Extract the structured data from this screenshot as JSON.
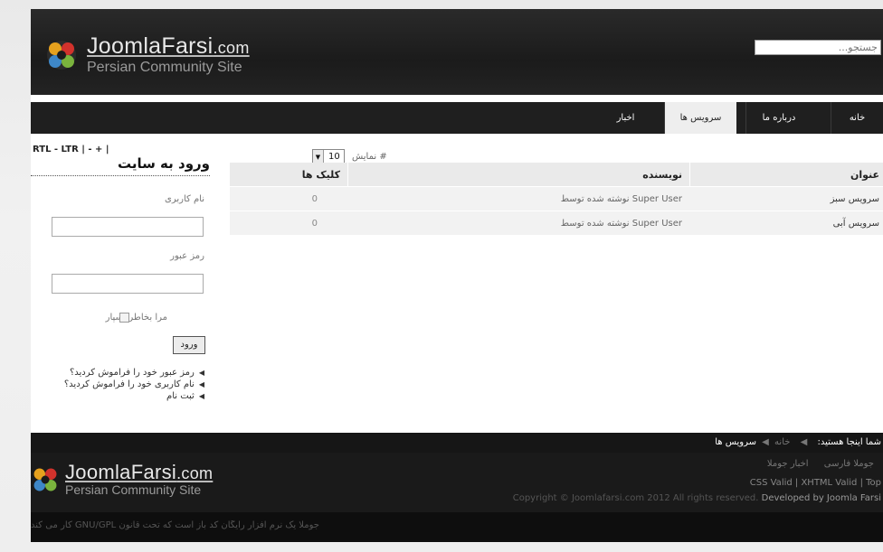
{
  "header": {
    "logo_main": "JoomlaFarsi",
    "logo_com": ".com",
    "logo_sub": "Persian Community Site",
    "search_placeholder": "جستجو..."
  },
  "nav": {
    "items": [
      {
        "label": "خانه"
      },
      {
        "label": "درباره ما"
      },
      {
        "label": "سرویس ها"
      },
      {
        "label": "اخبار"
      }
    ],
    "active": "سرویس ها"
  },
  "sidebar": {
    "toolbar": "RTL - LTR | -  +  |",
    "login_title": "ورود به سایت",
    "username_label": "نام کاربری",
    "password_label": "رمز عبور",
    "remember_label": "مرا بخاطر بسپار",
    "login_button": "ورود",
    "links": [
      "رمز عبور خود را فراموش کردید؟",
      "نام کاربری خود را فراموش کردید؟",
      "ثبت نام"
    ]
  },
  "main": {
    "display_label": "نمایش #",
    "display_value": "10",
    "columns": {
      "title": "عنوان",
      "author": "نویسنده",
      "clicks": "کلیک ها"
    },
    "rows": [
      {
        "title": "سرویس سبز",
        "author": "نوشته شده توسط Super User",
        "clicks": "0"
      },
      {
        "title": "سرویس آبی",
        "author": "نوشته شده توسط Super User",
        "clicks": "0"
      }
    ]
  },
  "footer": {
    "breadcrumb_label": "شما اینجا هستید:",
    "breadcrumb_home": "خانه",
    "breadcrumb_current": "سرویس ها",
    "logo_main": "JoomlaFarsi",
    "logo_com": ".com",
    "logo_sub": "Persian Community Site",
    "menu": [
      "جوملا فارسی",
      "اخبار جوملا"
    ],
    "valid_links": "CSS Valid | XHTML Valid | Top",
    "copyright": "Copyright © Joomlafarsi.com 2012 All rights reserved.",
    "developed": "Developed by Joomla Farsi",
    "license": "جوملا یک نرم افزار رایگان کد باز است که تحت قانون GNU/GPL کار می کند"
  },
  "colors": {
    "header_bg": "#1b1b1b",
    "nav_active_bg": "#eeeeee",
    "row_bg": "#f2f2f2"
  }
}
